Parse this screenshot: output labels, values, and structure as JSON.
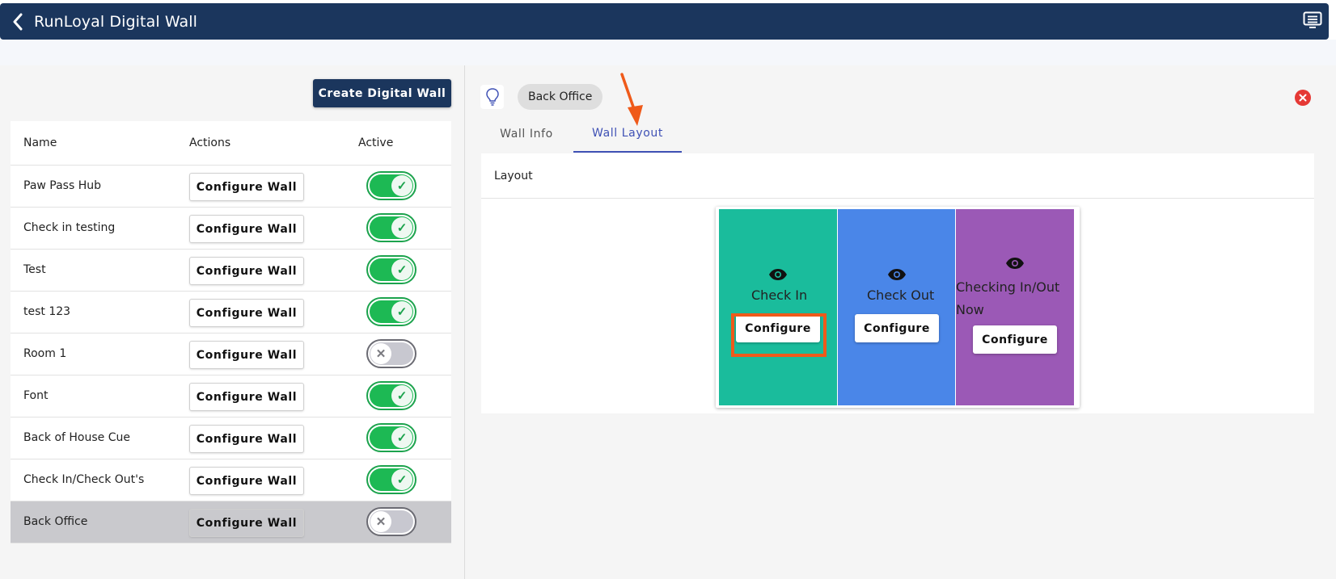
{
  "app": {
    "title": "RunLoyal Digital Wall"
  },
  "toolbar": {
    "create_label": "Create Digital Wall"
  },
  "table": {
    "headers": {
      "name": "Name",
      "actions": "Actions",
      "active": "Active"
    },
    "action_label": "Configure Wall",
    "rows": [
      {
        "name": "Paw Pass Hub",
        "active": true
      },
      {
        "name": "Check in testing",
        "active": true
      },
      {
        "name": "Test",
        "active": true
      },
      {
        "name": "test 123",
        "active": true
      },
      {
        "name": "Room 1",
        "active": false
      },
      {
        "name": "Font",
        "active": true
      },
      {
        "name": "Back of House Cue",
        "active": true
      },
      {
        "name": "Check In/Check Out's",
        "active": true
      },
      {
        "name": "Back Office",
        "active": false,
        "selected": true
      }
    ]
  },
  "detail": {
    "chip": "Back Office",
    "tabs": [
      {
        "label": "Wall Info",
        "active": false
      },
      {
        "label": "Wall Layout",
        "active": true
      }
    ],
    "layout_title": "Layout",
    "columns": [
      {
        "label": "Check In",
        "color": "#1abc9c",
        "button": "Configure",
        "highlighted": true
      },
      {
        "label": "Check Out",
        "color": "#4a86e8",
        "button": "Configure"
      },
      {
        "label": "Checking In/Out Now",
        "color": "#9b59b6",
        "button": "Configure"
      }
    ]
  },
  "colors": {
    "brand": "#1b365d",
    "toggle_on": "#1db954",
    "accent_tab": "#3f51b5",
    "annotation": "#ef5a1a",
    "close": "#e53935"
  }
}
